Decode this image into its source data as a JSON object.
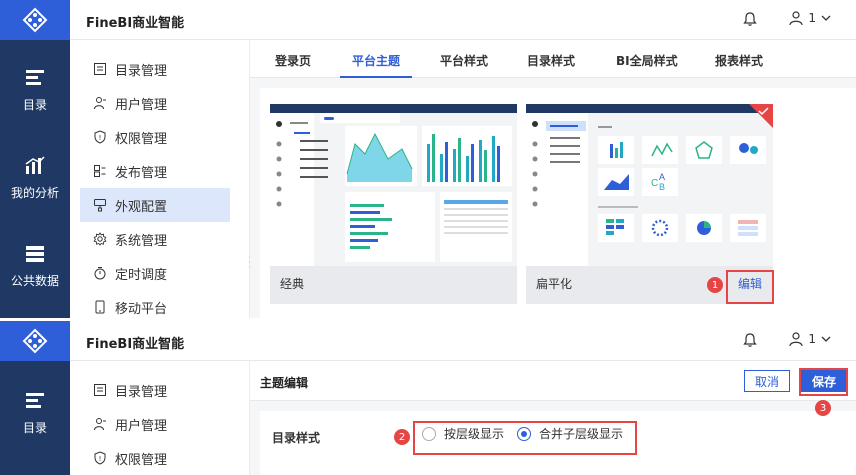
{
  "app": {
    "title": "FineBI商业智能",
    "user_label": "1",
    "colors": {
      "brand": "#2e5fd8",
      "rail": "#1f3864",
      "highlight": "#e54545"
    }
  },
  "rail": {
    "items": [
      {
        "label": "目录",
        "icon": "catalog-icon"
      },
      {
        "label": "我的分析",
        "icon": "analysis-icon"
      },
      {
        "label": "公共数据",
        "icon": "database-icon"
      }
    ]
  },
  "sidenav": {
    "items": [
      {
        "label": "目录管理",
        "icon": "directory-icon"
      },
      {
        "label": "用户管理",
        "icon": "user-icon"
      },
      {
        "label": "权限管理",
        "icon": "shield-icon"
      },
      {
        "label": "发布管理",
        "icon": "publish-icon"
      },
      {
        "label": "外观配置",
        "icon": "appearance-icon",
        "active": true
      },
      {
        "label": "系统管理",
        "icon": "gear-icon"
      },
      {
        "label": "定时调度",
        "icon": "timer-icon"
      },
      {
        "label": "移动平台",
        "icon": "mobile-icon"
      }
    ]
  },
  "tabs": [
    "登录页",
    "平台主题",
    "平台样式",
    "目录样式",
    "BI全局样式",
    "报表样式"
  ],
  "active_tab": "平台主题",
  "themes": [
    {
      "name": "经典"
    },
    {
      "name": "扁平化",
      "selected": true,
      "action": "编辑"
    }
  ],
  "editor": {
    "title": "主题编辑",
    "cancel_label": "取消",
    "save_label": "保存",
    "catalog_style_label": "目录样式",
    "options": [
      {
        "label": "按层级显示",
        "checked": false
      },
      {
        "label": "合并子层级显示",
        "checked": true
      }
    ]
  },
  "annotations": [
    "1",
    "2",
    "3"
  ]
}
